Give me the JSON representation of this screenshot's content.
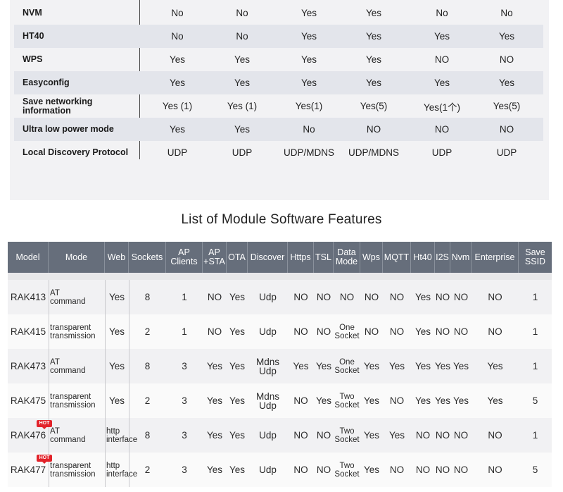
{
  "top_table": {
    "rows": [
      {
        "label": "NVM",
        "values": [
          "No",
          "No",
          "Yes",
          "Yes",
          "No",
          "No"
        ]
      },
      {
        "label": "HT40",
        "values": [
          "No",
          "No",
          "Yes",
          "Yes",
          "Yes",
          "Yes"
        ]
      },
      {
        "label": "WPS",
        "values": [
          "Yes",
          "Yes",
          "Yes",
          "Yes",
          "NO",
          "NO"
        ]
      },
      {
        "label": "Easyconfig",
        "values": [
          "Yes",
          "Yes",
          "Yes",
          "Yes",
          "Yes",
          "Yes"
        ]
      },
      {
        "label": "Save networking\ninformation",
        "values": [
          "Yes (1)",
          "Yes (1)",
          "Yes(1)",
          "Yes(5)",
          "Yes(1个)",
          "Yes(5)"
        ]
      },
      {
        "label": "Ultra low power mode",
        "values": [
          "Yes",
          "Yes",
          "No",
          "NO",
          "NO",
          "NO"
        ]
      },
      {
        "label": "Local Discovery Protocol",
        "values": [
          "UDP",
          "UDP",
          "UDP/MDNS",
          "UDP/MDNS",
          "UDP",
          "UDP"
        ]
      }
    ]
  },
  "section_title": "List of Module Software Features",
  "feature_table": {
    "headers": [
      "Model",
      "Mode",
      "Web",
      "Sockets",
      "AP\nClients",
      "AP\n+STA",
      "OTA",
      "Discover",
      "Https",
      "TSL",
      "Data\nMode",
      "Wps",
      "MQTT",
      "Ht40",
      "I2S",
      "Nvm",
      "Enterprise",
      "Save\nSSID"
    ],
    "hot_badge": "HOT",
    "rows": [
      {
        "hot": false,
        "cells": [
          "RAK413",
          "AT\ncommand",
          "Yes",
          "8",
          "1",
          "NO",
          "Yes",
          "Udp",
          "NO",
          "NO",
          "NO",
          "NO",
          "NO",
          "Yes",
          "NO",
          "NO",
          "NO",
          "1"
        ]
      },
      {
        "hot": false,
        "cells": [
          "RAK415",
          "transparent\ntransmission",
          "Yes",
          "2",
          "1",
          "NO",
          "Yes",
          "Udp",
          "NO",
          "NO",
          "One\nSocket",
          "NO",
          "NO",
          "Yes",
          "NO",
          "NO",
          "NO",
          "1"
        ]
      },
      {
        "hot": false,
        "cells": [
          "RAK473",
          "AT\ncommand",
          "Yes",
          "8",
          "3",
          "Yes",
          "Yes",
          "Mdns\nUdp",
          "Yes",
          "Yes",
          "One\nSocket",
          "Yes",
          "Yes",
          "Yes",
          "Yes",
          "Yes",
          "Yes",
          "1"
        ]
      },
      {
        "hot": false,
        "cells": [
          "RAK475",
          "transparent\ntransmission",
          "Yes",
          "2",
          "3",
          "Yes",
          "Yes",
          "Mdns\nUdp",
          "NO",
          "Yes",
          "Two\nSocket",
          "Yes",
          "NO",
          "Yes",
          "Yes",
          "Yes",
          "Yes",
          "5"
        ]
      },
      {
        "hot": true,
        "cells": [
          "RAK476",
          "AT\ncommand",
          "http\ninterface",
          "8",
          "3",
          "Yes",
          "Yes",
          "Udp",
          "NO",
          "NO",
          "Two\nSocket",
          "Yes",
          "Yes",
          "NO",
          "NO",
          "NO",
          "NO",
          "1"
        ]
      },
      {
        "hot": true,
        "cells": [
          "RAK477",
          "transparent\ntransmission",
          "http\ninterface",
          "2",
          "3",
          "Yes",
          "Yes",
          "Udp",
          "NO",
          "NO",
          "Two\nSocket",
          "Yes",
          "NO",
          "NO",
          "NO",
          "NO",
          "NO",
          "5"
        ]
      }
    ]
  }
}
